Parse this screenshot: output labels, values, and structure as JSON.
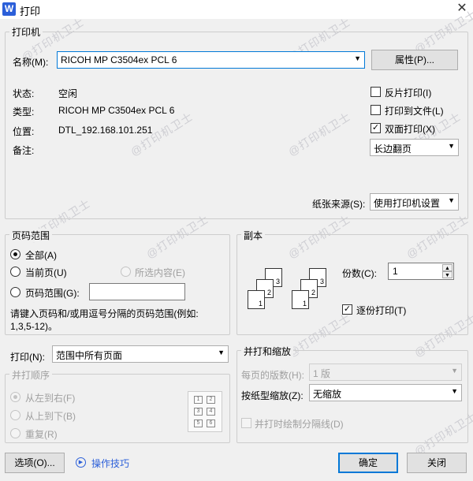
{
  "title": "打印",
  "app_icon": "W",
  "printer_group": {
    "legend": "打印机",
    "name_label": "名称(M):",
    "name_value": "RICOH MP C3504ex PCL 6",
    "properties_btn": "属性(P)...",
    "status_label": "状态:",
    "status_value": "空闲",
    "type_label": "类型:",
    "type_value": "RICOH MP C3504ex PCL 6",
    "location_label": "位置:",
    "location_value": "DTL_192.168.101.251",
    "comment_label": "备注:",
    "reverse_print": "反片打印(I)",
    "print_to_file": "打印到文件(L)",
    "duplex": "双面打印(X)",
    "duplex_mode": "长边翻页",
    "paper_source_label": "纸张来源(S):",
    "paper_source_value": "使用打印机设置"
  },
  "range_group": {
    "legend": "页码范围",
    "all": "全部(A)",
    "current": "当前页(U)",
    "selection": "所选内容(E)",
    "pages": "页码范围(G):",
    "pages_value": "",
    "hint": "请键入页码和/或用逗号分隔的页码范围(例如: 1,3,5-12)。"
  },
  "copies_group": {
    "legend": "副本",
    "copies_label": "份数(C):",
    "copies_value": "1",
    "collate": "逐份打印(T)"
  },
  "print_what": {
    "label": "打印(N):",
    "value": "范围中所有页面"
  },
  "merge_order": {
    "legend": "并打顺序",
    "left_right": "从左到右(F)",
    "top_bottom": "从上到下(B)",
    "repeat": "重复(R)"
  },
  "zoom_group": {
    "legend": "并打和缩放",
    "pages_per_sheet_label": "每页的版数(H):",
    "pages_per_sheet_value": "1 版",
    "scale_label": "按纸型缩放(Z):",
    "scale_value": "无缩放",
    "draw_borders": "并打时绘制分隔线(D)"
  },
  "footer": {
    "options": "选项(O)...",
    "tips": "操作技巧",
    "ok": "确定",
    "close": "关闭"
  },
  "watermark": "@打印机卫士",
  "colors": {
    "accent": "#0078d7",
    "tips_link": "#2b5fd9"
  }
}
